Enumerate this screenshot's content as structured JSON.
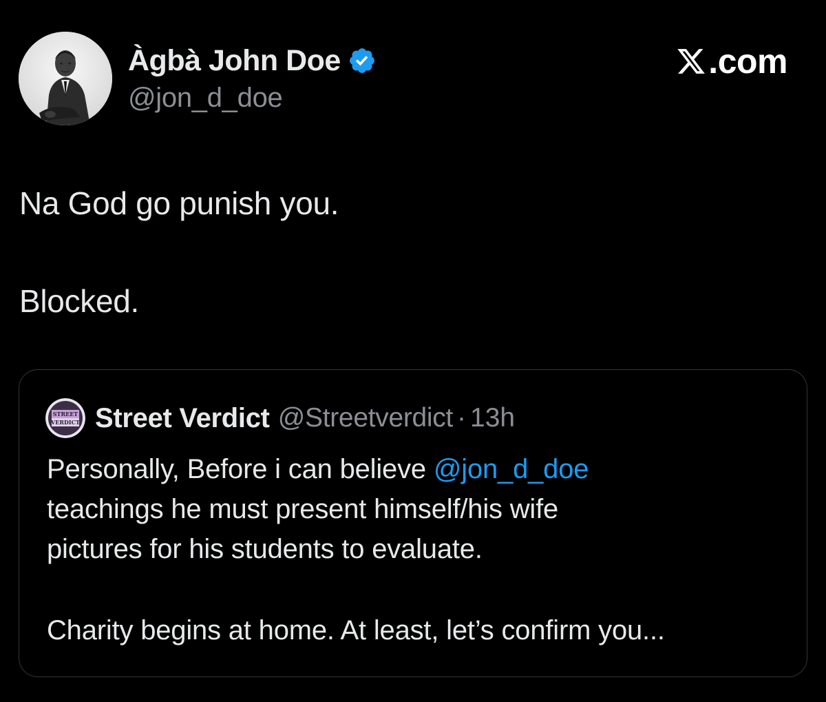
{
  "author": {
    "display_name": "Àgbà John Doe",
    "handle": "@jon_d_doe",
    "verified": true,
    "avatar_icon": "person-portrait-avatar"
  },
  "brand": {
    "text": ".com",
    "logo_icon": "x-logo-icon"
  },
  "post": {
    "lines": [
      "Na God go punish you.",
      "Blocked."
    ]
  },
  "quoted_post": {
    "author": {
      "display_name": "Street Verdict",
      "handle": "@Streetverdict",
      "avatar_icon": "street-verdict-logo",
      "avatar_text_top": "STREET",
      "avatar_text_bottom": "VERDICT"
    },
    "separator": "·",
    "time": "13h",
    "line1_prefix": "Personally, Before i can believe ",
    "line1_mention": "@jon_d_doe",
    "line2": "teachings he must present himself/his wife",
    "line3": "pictures for his students to evaluate.",
    "line4": "Charity begins at home. At least, let’s confirm you..."
  },
  "colors": {
    "background": "#000000",
    "text": "#e7e9ea",
    "secondary_text": "#8b8f94",
    "link": "#1d9bf0",
    "verified_badge": "#1d9bf0",
    "card_border": "#333639"
  }
}
